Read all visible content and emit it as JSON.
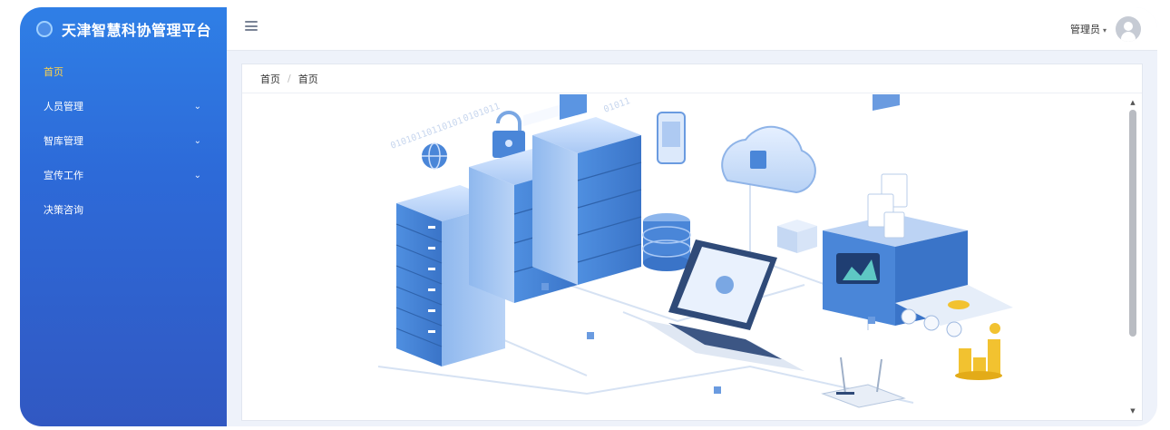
{
  "app": {
    "title": "天津智慧科协管理平台"
  },
  "sidebar": {
    "items": [
      {
        "label": "首页",
        "active": true,
        "expandable": false
      },
      {
        "label": "人员管理",
        "active": false,
        "expandable": true
      },
      {
        "label": "智库管理",
        "active": false,
        "expandable": true
      },
      {
        "label": "宣传工作",
        "active": false,
        "expandable": true
      },
      {
        "label": "决策咨询",
        "active": false,
        "expandable": false
      }
    ]
  },
  "header": {
    "user": "管理员"
  },
  "breadcrumb": [
    "首页",
    "首页"
  ],
  "colors": {
    "sidebar": "#2f6fe0",
    "active": "#ffd24a",
    "accent": "#3a7bd5"
  },
  "icons": {
    "menu": "hamburger-icon",
    "avatar": "user-avatar-icon",
    "dropdown": "chevron-down-icon"
  }
}
